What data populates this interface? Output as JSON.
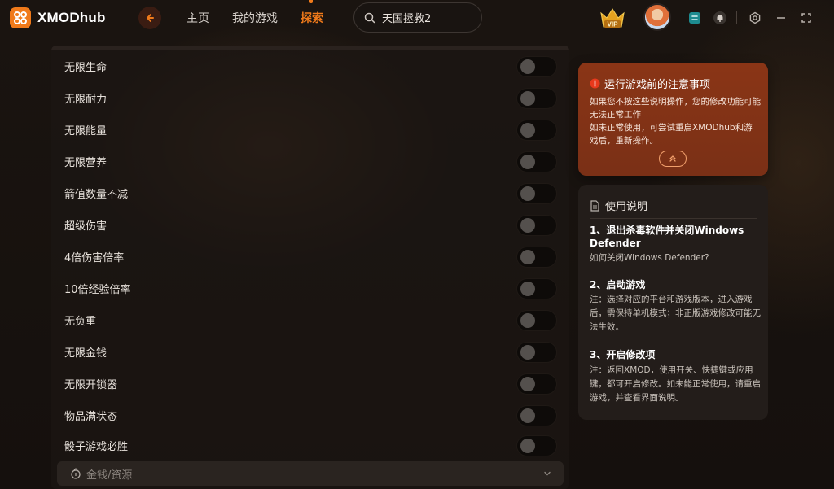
{
  "app": {
    "name": "XMODhub",
    "brand_color": "#f07a1a"
  },
  "nav": {
    "back_icon": "arrow-left-icon",
    "items": [
      {
        "label": "主页",
        "active": false
      },
      {
        "label": "我的游戏",
        "active": false
      },
      {
        "label": "探索",
        "active": true
      }
    ]
  },
  "search": {
    "value": "天国拯救2",
    "icon": "search-icon"
  },
  "topbar_right": {
    "vip_label": "VIP",
    "icons": [
      "vip-badge-icon",
      "avatar",
      "mod-cube-icon",
      "notification-icon",
      "settings-icon",
      "minimize-icon",
      "fullscreen-icon"
    ]
  },
  "cheats": [
    {
      "label": "无限生命",
      "enabled": false
    },
    {
      "label": "无限耐力",
      "enabled": false
    },
    {
      "label": "无限能量",
      "enabled": false
    },
    {
      "label": "无限营养",
      "enabled": false
    },
    {
      "label": "箭值数量不减",
      "enabled": false
    },
    {
      "label": "超级伤害",
      "enabled": false
    },
    {
      "label": "4倍伤害倍率",
      "enabled": false
    },
    {
      "label": "10倍经验倍率",
      "enabled": false
    },
    {
      "label": "无负重",
      "enabled": false
    },
    {
      "label": "无限金钱",
      "enabled": false
    },
    {
      "label": "无限开锁器",
      "enabled": false
    },
    {
      "label": "物品满状态",
      "enabled": false
    },
    {
      "label": "骰子游戏必胜",
      "enabled": false
    }
  ],
  "category": {
    "label": "金钱/资源",
    "icon": "coin-icon",
    "expanded": false
  },
  "notice": {
    "title": "运行游戏前的注意事项",
    "line1": "如果您不按这些说明操作，您的修改功能可能无法正常工作",
    "line2": "如未正常使用，可尝试重启XMODhub和游戏后，重新操作。"
  },
  "instructions": {
    "title": "使用说明",
    "step1_title": "1、退出杀毒软件并关闭Windows Defender",
    "step1_note": "如何关闭Windows Defender?",
    "step2_title": "2、启动游戏",
    "step2_note_a": "注：选择对应的平台和游戏版本，进入游戏后，需保持",
    "step2_link1": "单机模式",
    "step2_note_b": "；",
    "step2_link2": "非正版",
    "step2_note_c": "游戏修改可能无法生效。",
    "step3_title": "3、开启修改项",
    "step3_note": "注：返回XMOD，使用开关、快捷键或应用键，都可开启修改。如未能正常使用，请重启游戏，并查看界面说明。"
  }
}
